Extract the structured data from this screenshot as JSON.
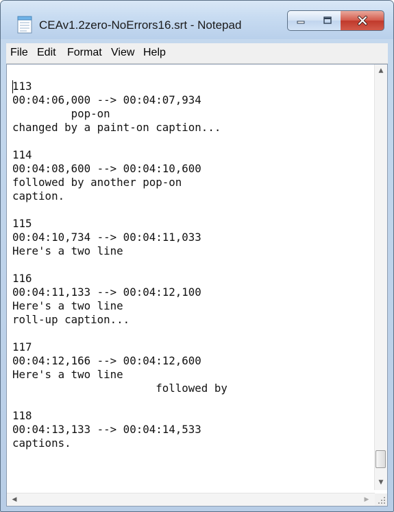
{
  "window": {
    "title": "CEAv1.2zero-NoErrors16.srt - Notepad",
    "minimize_icon": "minimize-icon",
    "maximize_icon": "maximize-icon",
    "close_icon": "close-icon"
  },
  "menu": {
    "items": [
      "File",
      "Edit",
      "Format",
      "View",
      "Help"
    ]
  },
  "document": {
    "text": "113\n00:04:06,000 --> 00:04:07,934\n         pop-on\nchanged by a paint-on caption...\n\n114\n00:04:08,600 --> 00:04:10,600\nfollowed by another pop-on\ncaption.\n\n115\n00:04:10,734 --> 00:04:11,033\nHere's a two line\n\n116\n00:04:11,133 --> 00:04:12,100\nHere's a two line\nroll-up caption...\n\n117\n00:04:12,166 --> 00:04:12,600\nHere's a two line\n                      followed by\n\n118\n00:04:13,133 --> 00:04:14,533\ncaptions."
  },
  "scrollbars": {
    "up_icon": "scroll-up-arrow-icon",
    "down_icon": "scroll-down-arrow-icon",
    "left_icon": "scroll-left-arrow-icon",
    "right_icon": "scroll-right-arrow-icon",
    "vertical_position": 0.93
  },
  "colors": {
    "title_bar": "#c7dbf1",
    "close_button": "#c0392b",
    "editor_background": "#ffffff"
  }
}
